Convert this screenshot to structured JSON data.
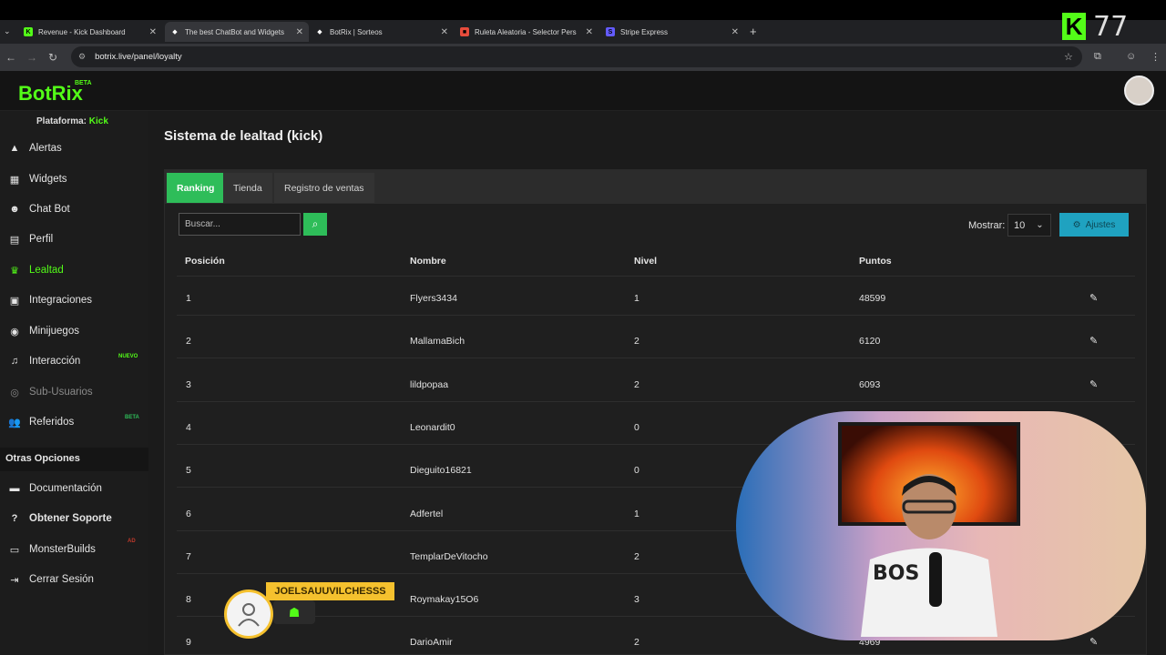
{
  "browser": {
    "tabs": [
      {
        "title": "Revenue - Kick Dashboard",
        "favicon": "K",
        "fav_color": "#53fc18"
      },
      {
        "title": "The best ChatBot and Widgets",
        "favicon": "◆",
        "fav_color": "#ffffff"
      },
      {
        "title": "BotRix | Sorteos",
        "favicon": "◆",
        "fav_color": "#ffffff"
      },
      {
        "title": "Ruleta Aleatoria - Selector Pers",
        "favicon": "■",
        "fav_color": "#e74c3c"
      },
      {
        "title": "Stripe Express",
        "favicon": "S",
        "fav_color": "#635bff"
      }
    ],
    "new_tab": "+",
    "url": "botrix.live/panel/loyalty"
  },
  "overlay": {
    "kick_logo": "K",
    "viewer_count": "77"
  },
  "header": {
    "logo": "BotRix",
    "logo_badge": "BETA"
  },
  "sidebar": {
    "platform_label": "Plataforma:",
    "platform_value": "Kick",
    "items": [
      {
        "label": "Alertas",
        "icon": "warning-icon",
        "glyph": "▲"
      },
      {
        "label": "Widgets",
        "icon": "widgets-icon",
        "glyph": "▦"
      },
      {
        "label": "Chat Bot",
        "icon": "robot-icon",
        "glyph": "☻"
      },
      {
        "label": "Perfil",
        "icon": "profile-card-icon",
        "glyph": "▤"
      },
      {
        "label": "Lealtad",
        "icon": "trophy-icon",
        "glyph": "♛"
      },
      {
        "label": "Integraciones",
        "icon": "integrations-icon",
        "glyph": "▣"
      },
      {
        "label": "Minijuegos",
        "icon": "gamepad-icon",
        "glyph": "◉"
      },
      {
        "label": "Interacción",
        "icon": "music-icon",
        "glyph": "♫",
        "badge": "NUEVO"
      },
      {
        "label": "Sub-Usuarios",
        "icon": "users-icon",
        "glyph": "◎"
      },
      {
        "label": "Referidos",
        "icon": "referrals-icon",
        "glyph": "👥",
        "badge": "BETA"
      }
    ],
    "other_title": "Otras Opciones",
    "other_items": [
      {
        "label": "Documentación",
        "icon": "docs-icon",
        "glyph": "▬"
      },
      {
        "label": "Obtener Soporte",
        "icon": "help-icon",
        "glyph": "?"
      },
      {
        "label": "MonsterBuilds",
        "icon": "monitor-icon",
        "glyph": "▭",
        "badge": "AD"
      },
      {
        "label": "Cerrar Sesión",
        "icon": "logout-icon",
        "glyph": "⇥"
      }
    ]
  },
  "main": {
    "title": "Sistema de lealtad (kick)",
    "tabs": [
      "Ranking",
      "Tienda",
      "Registro de ventas"
    ],
    "search_placeholder": "Buscar...",
    "show_label": "Mostrar:",
    "show_value": "10",
    "settings_label": "Ajustes",
    "columns": [
      "Posición",
      "Nombre",
      "Nivel",
      "Puntos"
    ],
    "rows": [
      {
        "pos": "1",
        "name": "Flyers3434",
        "level": "1",
        "points": "48599"
      },
      {
        "pos": "2",
        "name": "MallamaBich",
        "level": "2",
        "points": "6120"
      },
      {
        "pos": "3",
        "name": "lildpopaa",
        "level": "2",
        "points": "6093"
      },
      {
        "pos": "4",
        "name": "Leonardit0",
        "level": "0",
        "points": ""
      },
      {
        "pos": "5",
        "name": "Dieguito16821",
        "level": "0",
        "points": ""
      },
      {
        "pos": "6",
        "name": "Adfertel",
        "level": "1",
        "points": ""
      },
      {
        "pos": "7",
        "name": "TemplarDeVitocho",
        "level": "2",
        "points": ""
      },
      {
        "pos": "8",
        "name": "Roymakay15O6",
        "level": "3",
        "points": ""
      },
      {
        "pos": "9",
        "name": "DarioAmir",
        "level": "2",
        "points": "4969"
      }
    ]
  },
  "chat": {
    "username": "JOELSAUUVILCHESSS"
  },
  "webcam": {
    "shirt_text": "BOS"
  },
  "colors": {
    "brand": "#53fc18",
    "accent": "#2ebd59",
    "settings": "#1fa2c0",
    "badge": "#f5c12e"
  }
}
